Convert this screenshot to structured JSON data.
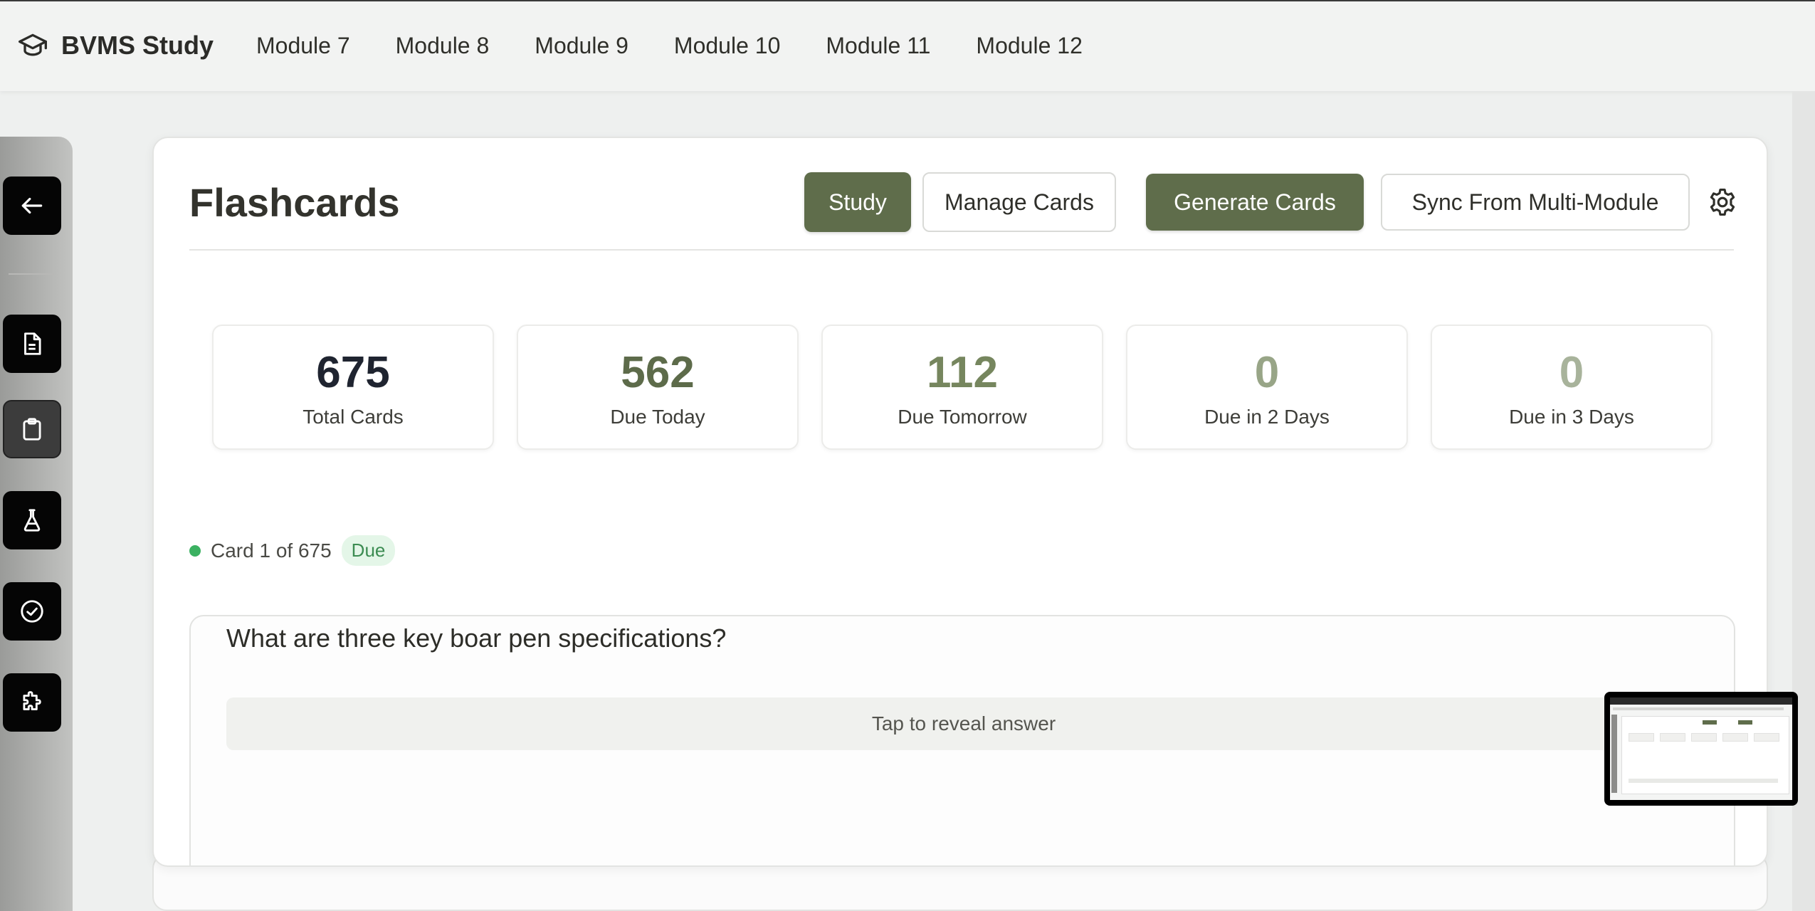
{
  "app": {
    "name": "BVMS Study",
    "nav": [
      "Module 7",
      "Module 8",
      "Module 9",
      "Module 10",
      "Module 11",
      "Module 12"
    ]
  },
  "sidebar": {
    "items": [
      {
        "icon": "arrow-left-icon",
        "label": "Back"
      },
      {
        "icon": "document-icon",
        "label": "Notes"
      },
      {
        "icon": "clipboard-icon",
        "label": "Flashcards"
      },
      {
        "icon": "flask-icon",
        "label": "Lab"
      },
      {
        "icon": "check-circle-icon",
        "label": "Quiz"
      },
      {
        "icon": "puzzle-icon",
        "label": "Extensions"
      }
    ]
  },
  "page": {
    "title": "Flashcards",
    "buttons": {
      "study": "Study",
      "manage": "Manage Cards",
      "generate": "Generate Cards",
      "sync": "Sync From Multi-Module"
    }
  },
  "stats": [
    {
      "value": "675",
      "label": "Total Cards",
      "color": "#1f2430"
    },
    {
      "value": "562",
      "label": "Due Today",
      "color": "#5d6b4a"
    },
    {
      "value": "112",
      "label": "Due Tomorrow",
      "color": "#76865e"
    },
    {
      "value": "0",
      "label": "Due in 2 Days",
      "color": "#98a587"
    },
    {
      "value": "0",
      "label": "Due in 3 Days",
      "color": "#a8b39b"
    }
  ],
  "card": {
    "counter": "Card 1 of 675",
    "badge": "Due",
    "question": "What are three key boar pen specifications?",
    "reveal": "Tap to reveal answer"
  },
  "colors": {
    "primary": "#5f6d4b",
    "status_green": "#3bb161"
  }
}
